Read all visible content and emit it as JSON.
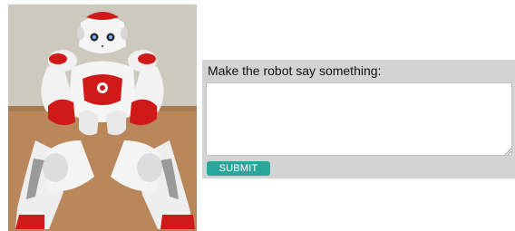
{
  "photo": {
    "subject": "robot-image"
  },
  "form": {
    "label": "Make the robot say something:",
    "input_value": "",
    "submit_label": "SUBMIT"
  },
  "colors": {
    "panel_background": "#d3d3d3",
    "submit_button": "#2aa79b",
    "robot_accent": "#d01a1a"
  }
}
